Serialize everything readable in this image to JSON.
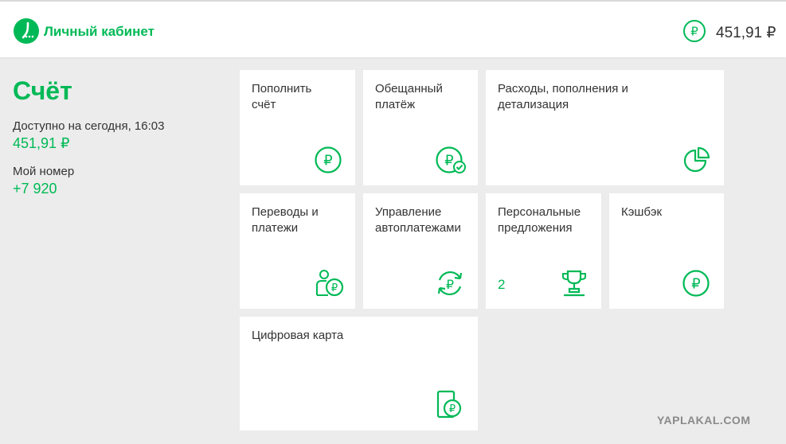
{
  "header": {
    "brand": "Личный кабинет",
    "balance": "451,91 ₽"
  },
  "account": {
    "title": "Счёт",
    "available_label": "Доступно на сегодня, 16:03",
    "available_value": "451,91 ₽",
    "number_label": "Мой номер",
    "number_value": "+7 920"
  },
  "tiles": [
    {
      "label": "Пополнить\nсчёт",
      "icon": "ruble-circle-icon"
    },
    {
      "label": "Обещанный\nплатёж",
      "icon": "ruble-check-icon"
    },
    {
      "label": "Расходы, пополнения и\nдетализация",
      "icon": "pie-chart-icon"
    },
    {
      "label": "Переводы и\nплатежи",
      "icon": "person-ruble-icon"
    },
    {
      "label": "Управление\nавтоплатежами",
      "icon": "autopay-icon"
    },
    {
      "label": "Персональные\nпредложения",
      "icon": "trophy-icon",
      "count": "2"
    },
    {
      "label": "Кэшбэк",
      "icon": "ruble-circle-icon"
    },
    {
      "label": "Цифровая карта",
      "icon": "card-ruble-icon"
    }
  ],
  "watermark": "YAPLAKAL.COM",
  "colors": {
    "accent": "#00b956",
    "background": "#ececec",
    "tile": "#ffffff"
  }
}
